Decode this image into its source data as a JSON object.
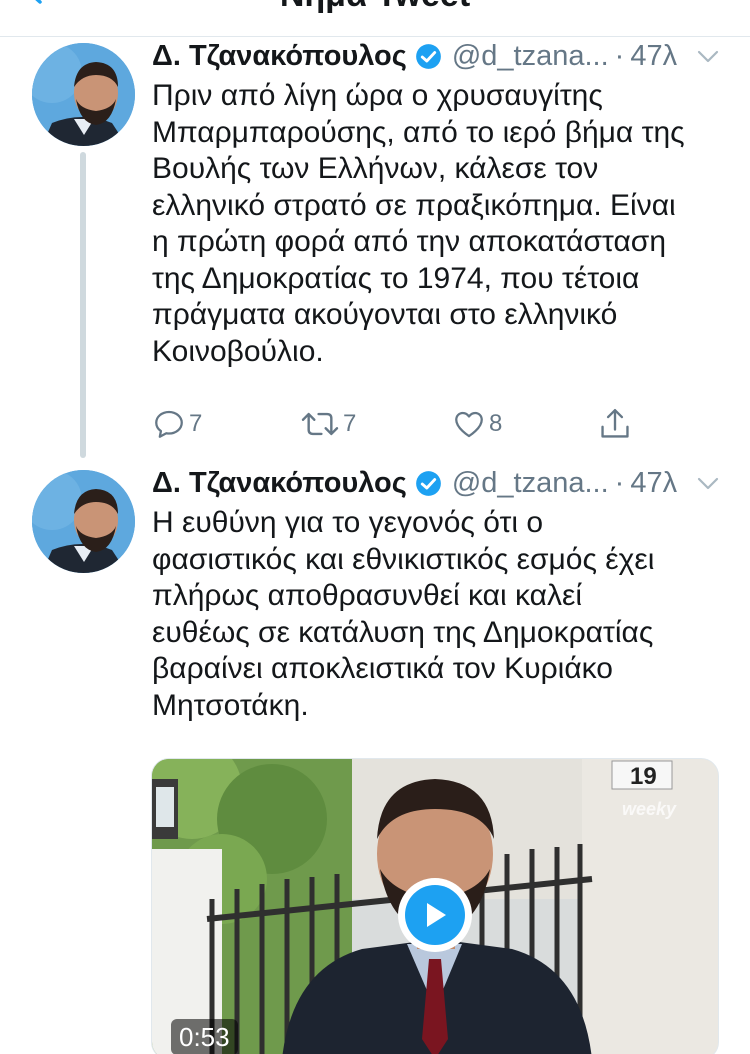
{
  "header": {
    "title": "Νήμα Tweet"
  },
  "tweets": [
    {
      "author_name": "Δ. Τζανακόπουλος",
      "handle": "@d_tzana...",
      "separator": "·",
      "time": "47λ",
      "lines": [
        "Πριν από λίγη ώρα ο χρυσαυγίτης",
        "Μπαρμπαρούσης, από το ιερό βήμα της",
        "Βουλής των Ελλήνων, κάλεσε τον",
        "ελληνικό στρατό σε πραξικόπημα. Είναι",
        "η πρώτη φορά από την αποκατάσταση",
        "της Δημοκρατίας το 1974, που τέτοια",
        "πράγματα ακούγονται στο ελληνικό",
        "Κοινοβούλιο."
      ],
      "replies": "7",
      "retweets": "7",
      "likes": "8"
    },
    {
      "author_name": "Δ. Τζανακόπουλος",
      "handle": "@d_tzana...",
      "separator": "·",
      "time": "47λ",
      "lines": [
        "Η ευθύνη για το γεγονός ότι ο",
        "φασιστικός και εθνικιστικός εσμός έχει",
        "πλήρως αποθρασυνθεί και καλεί",
        "ευθέως σε κατάλυση της Δημοκρατίας",
        "βαραίνει αποκλειστικά τον Κυριάκο",
        "Μητσοτάκη."
      ],
      "video": {
        "duration": "0:53",
        "watermark": "weeky",
        "plaque": "19"
      }
    }
  ],
  "icons": {
    "back": "chevron-left-icon",
    "verified": "verified-badge-icon",
    "caret": "chevron-down-icon",
    "reply": "reply-icon",
    "retweet": "retweet-icon",
    "like": "heart-icon",
    "share": "share-icon",
    "play": "play-icon"
  },
  "colors": {
    "accent": "#1da1f2",
    "secondary_text": "#657786",
    "divider": "#e1e8ed"
  }
}
